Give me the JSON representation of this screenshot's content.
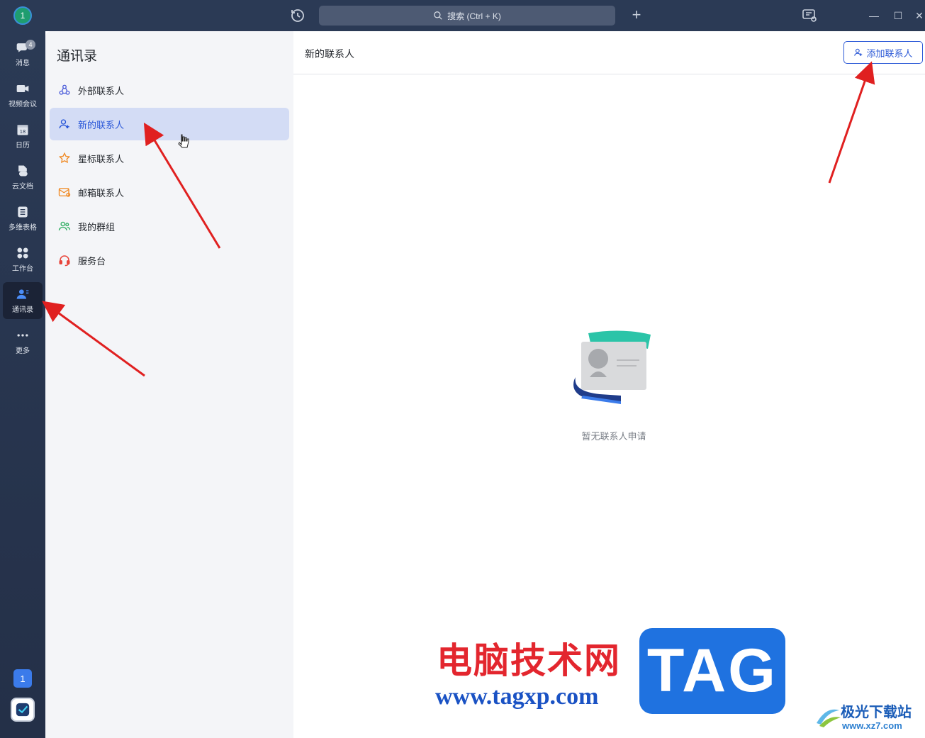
{
  "titlebar": {
    "avatar_text": "1",
    "search_label": "搜索 (Ctrl + K)",
    "plus_label": "+",
    "minimize_label": "—",
    "maximize_label": "☐",
    "close_label": "✕"
  },
  "rail": {
    "items": [
      {
        "label": "消息",
        "icon": "chat-bubble-icon",
        "badge": "4"
      },
      {
        "label": "视频会议",
        "icon": "video-camera-icon"
      },
      {
        "label": "日历",
        "icon": "calendar-icon",
        "icon_text": "18"
      },
      {
        "label": "云文档",
        "icon": "cloud-document-icon"
      },
      {
        "label": "多维表格",
        "icon": "spreadsheet-icon"
      },
      {
        "label": "工作台",
        "icon": "grid-apps-icon"
      },
      {
        "label": "通讯录",
        "icon": "contacts-icon",
        "active": true
      },
      {
        "label": "更多",
        "icon": "more-dots-icon"
      }
    ],
    "bottom_number": "1"
  },
  "panel": {
    "title": "通讯录",
    "items": [
      {
        "label": "外部联系人",
        "icon": "external-contacts-icon",
        "color": "#4a5bd9"
      },
      {
        "label": "新的联系人",
        "icon": "add-contact-icon",
        "color": "#2856d8",
        "active": true
      },
      {
        "label": "星标联系人",
        "icon": "star-icon",
        "color": "#f08a24"
      },
      {
        "label": "邮箱联系人",
        "icon": "mail-contact-icon",
        "color": "#f08a24"
      },
      {
        "label": "我的群组",
        "icon": "group-icon",
        "color": "#2fae62"
      },
      {
        "label": "服务台",
        "icon": "headset-icon",
        "color": "#e8443a"
      }
    ]
  },
  "main": {
    "title": "新的联系人",
    "add_button_label": "添加联系人",
    "empty_text": "暂无联系人申请"
  },
  "watermark": {
    "cn_text": "电脑技术网",
    "url_text": "www.tagxp.com",
    "tag_text": "TAG",
    "site2_title": "极光下载站",
    "site2_url": "www.xz7.com"
  },
  "colors": {
    "titlebar_bg": "#2b3a55",
    "accent": "#2856d8",
    "active_item_bg": "#d3dcf5",
    "arrow": "#e02020"
  }
}
